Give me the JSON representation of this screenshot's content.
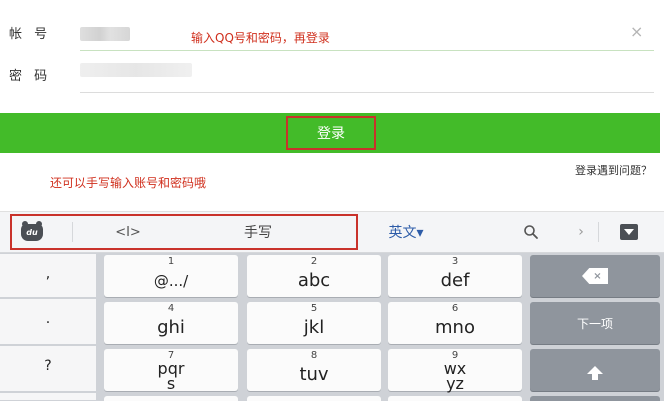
{
  "form": {
    "account_label": "帐 号",
    "password_label": "密 码",
    "annotation_top": "输入QQ号和密码，再登录",
    "clear_icon": "×",
    "login_button": "登录",
    "annotation_bottom": "还可以手写输入账号和密码哦",
    "help_link": "登录遇到问题？"
  },
  "toolbar": {
    "cursor_icon": "<I>",
    "handwrite": "手写",
    "lang": "英文▾",
    "search_icon": "🔍",
    "arrow": "›"
  },
  "keyboard": {
    "side": [
      ",",
      ".",
      "?"
    ],
    "keys": [
      {
        "num": "1",
        "letters": "@.../"
      },
      {
        "num": "2",
        "letters": "abc"
      },
      {
        "num": "3",
        "letters": "def"
      },
      {
        "num": "4",
        "letters": "ghi"
      },
      {
        "num": "5",
        "letters": "jkl"
      },
      {
        "num": "6",
        "letters": "mno"
      },
      {
        "num": "7",
        "letters": "pqrs"
      },
      {
        "num": "8",
        "letters": "tuv"
      },
      {
        "num": "9",
        "letters": "wxyz"
      }
    ],
    "backspace_icon": "×",
    "next_item": "下一项"
  },
  "colors": {
    "accent_green": "#43bb29",
    "annotation_red": "#d0301e",
    "keyboard_bg": "#cfd2d7"
  }
}
